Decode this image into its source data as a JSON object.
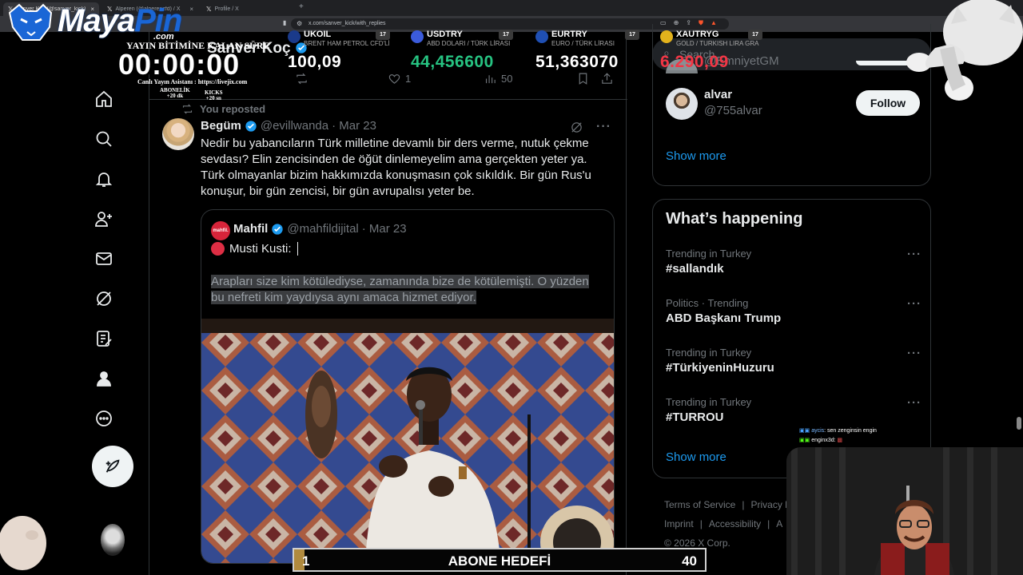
{
  "browser": {
    "tabs": [
      {
        "label": "Sanver Koç (@sanver_kick) / X",
        "active": true
      },
      {
        "label": "Alperen (@alperenzfd) / X",
        "active": false
      },
      {
        "label": "Profile / X",
        "active": false
      }
    ],
    "url": "x.com/sanver_kick/with_replies"
  },
  "profile_header": {
    "name": "Sanver Koç"
  },
  "top_tweet_actions": {
    "likes": "1",
    "views": "50"
  },
  "tweet": {
    "repost_label": "You reposted",
    "author_name": "Begüm",
    "author_handle": "@evillwanda",
    "date": "· Mar 23",
    "text": "Nedir bu yabancıların Türk milletine devamlı bir ders verme, nutuk çekme sevdası? Elin zencisinden de öğüt dinlemeyelim ama gerçekten yeter ya. Türk olmayanlar bizim hakkımızda konuşmasın çok sıkıldık. Bir gün Rus'u konuşur, bir gün zencisi, bir gün avrupalısı yeter be.",
    "quote": {
      "avatar_text": "mahfil.",
      "author_name": "Mahfil",
      "author_handle": "@mahfildijital",
      "date": "· Mar 23",
      "line1": "Musti Kusti:",
      "line2": "Arapları size kim kötülediyse, zamanında bize de kötülemişti. O yüzden bu nefreti kim yaydıysa aynı amaca hizmet ediyor."
    }
  },
  "right": {
    "search_placeholder": "Search",
    "wtf_top_handle": "@EmniyetGM",
    "follow_user": {
      "name": "alvar",
      "handle": "@755alvar",
      "button": "Follow"
    },
    "show_more_1": "Show more",
    "happening_title": "What’s happening",
    "trends": [
      {
        "context": "Trending in Turkey",
        "title": "#sallandık"
      },
      {
        "context": "Politics · Trending",
        "title": "ABD Başkanı Trump"
      },
      {
        "context": "Trending in Turkey",
        "title": "#TürkiyeninHuzuru"
      },
      {
        "context": "Trending in Turkey",
        "title": "#TURROU"
      }
    ],
    "show_more_2": "Show more",
    "footer": {
      "terms": "Terms of Service",
      "privacy": "Privacy P",
      "imprint": "Imprint",
      "accessibility": "Accessibility",
      "more_cut": "A",
      "copyright": "© 2026 X Corp."
    }
  },
  "overlay": {
    "brand_name": "Maya",
    "brand_name_2": "Pin",
    "brand_sub": ".com",
    "timer_label": "YAYIN BİTİMİNE KALAN SÜRE",
    "timer": "00:00:00",
    "assistant": "Canlı Yayın Asistanı : https://livejix.com",
    "abonelik_label": "ABONELİK",
    "abonelik_value": "+20 dk",
    "kicks_label": "KICKS",
    "kicks_value": "+20 sn",
    "tickers": [
      {
        "symbol": "UKOIL",
        "desc": "BRENT HAM PETROL CFD'Lİ",
        "value": "100,09",
        "color": "#ffffff",
        "badge": "#1a3a8a"
      },
      {
        "symbol": "USDTRY",
        "desc": "ABD DOLARI / TÜRK LİRASI",
        "value": "44,456600",
        "color": "#26c281",
        "badge": "#3b5bdb"
      },
      {
        "symbol": "EURTRY",
        "desc": "EURO / TÜRK LİRASI",
        "value": "51,363070",
        "color": "#ffffff",
        "badge": "#1f4fb3"
      },
      {
        "symbol": "XAUTRYG",
        "desc": "GOLD / TURKISH LIRA GRA",
        "value": "6.290,09",
        "color": "#f23645",
        "badge": "#e2b21c"
      }
    ],
    "ticker_tv": "17",
    "chat": [
      {
        "user": "aycis",
        "message": ": sen zenginsin engin"
      },
      {
        "user": "enginx3d",
        "message": ":"
      }
    ],
    "sub_goal": {
      "label": "ABONE HEDEFİ",
      "current": "1",
      "target": "40",
      "progress": 0.025
    }
  }
}
